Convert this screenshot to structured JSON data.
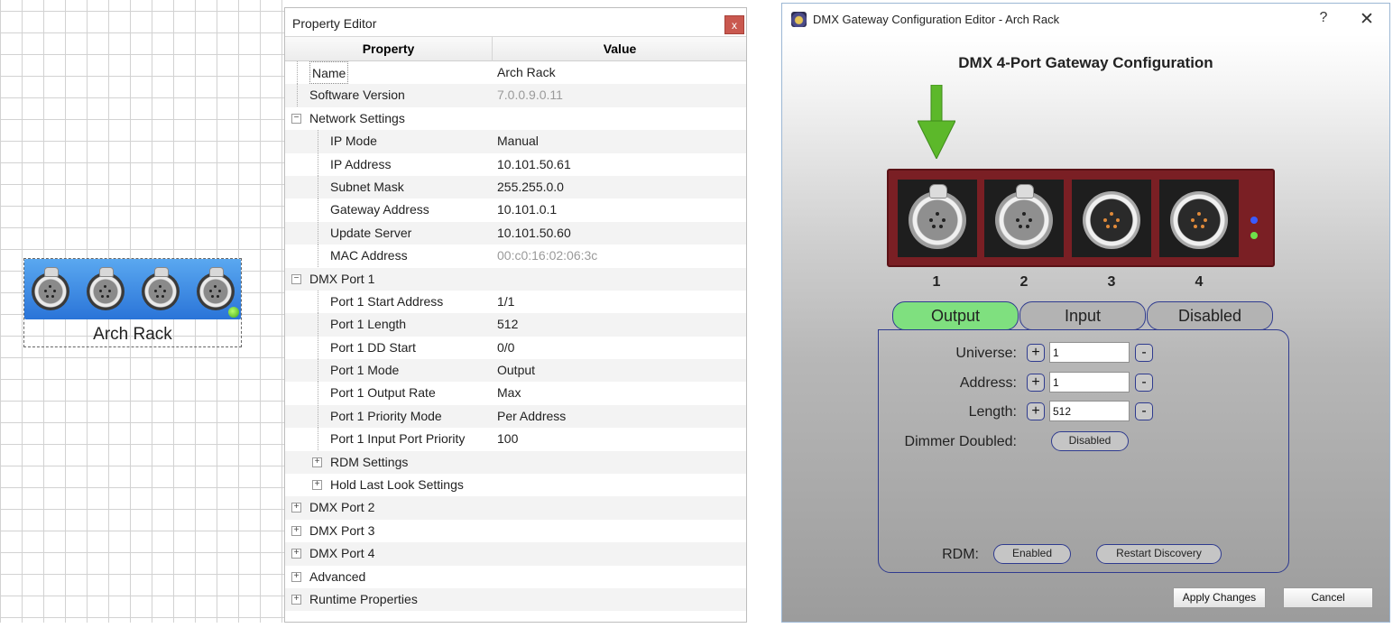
{
  "canvas": {
    "node": {
      "label": "Arch Rack"
    }
  },
  "property_editor": {
    "title": "Property Editor",
    "close_label": "x",
    "header": {
      "property": "Property",
      "value": "Value"
    },
    "rows": [
      {
        "name": "Name",
        "value": "Arch Rack"
      },
      {
        "name": "Software Version",
        "value": "7.0.0.9.0.11"
      },
      {
        "name": "Network Settings",
        "value": ""
      },
      {
        "name": "IP Mode",
        "value": "Manual"
      },
      {
        "name": "IP Address",
        "value": "10.101.50.61"
      },
      {
        "name": "Subnet Mask",
        "value": "255.255.0.0"
      },
      {
        "name": "Gateway Address",
        "value": "10.101.0.1"
      },
      {
        "name": "Update Server",
        "value": "10.101.50.60"
      },
      {
        "name": "MAC Address",
        "value": "00:c0:16:02:06:3c"
      },
      {
        "name": "DMX Port 1",
        "value": ""
      },
      {
        "name": "Port 1 Start Address",
        "value": "1/1"
      },
      {
        "name": "Port 1 Length",
        "value": "512"
      },
      {
        "name": "Port 1 DD Start",
        "value": "0/0"
      },
      {
        "name": "Port 1 Mode",
        "value": "Output"
      },
      {
        "name": "Port 1 Output Rate",
        "value": "Max"
      },
      {
        "name": "Port 1 Priority Mode",
        "value": "Per Address"
      },
      {
        "name": "Port 1 Input Port Priority",
        "value": "100"
      },
      {
        "name": "RDM Settings",
        "value": ""
      },
      {
        "name": "Hold Last Look Settings",
        "value": ""
      },
      {
        "name": "DMX Port 2",
        "value": ""
      },
      {
        "name": "DMX Port 3",
        "value": ""
      },
      {
        "name": "DMX Port 4",
        "value": ""
      },
      {
        "name": "Advanced",
        "value": ""
      },
      {
        "name": "Runtime Properties",
        "value": ""
      }
    ]
  },
  "dialog": {
    "title": "DMX Gateway Configuration Editor - Arch Rack",
    "help_label": "?",
    "close_label": "✕",
    "heading": "DMX 4-Port Gateway Configuration",
    "ports": [
      "1",
      "2",
      "3",
      "4"
    ],
    "modes": [
      "Output",
      "Input",
      "Disabled"
    ],
    "active_mode": "Output",
    "fields": {
      "universe_label": "Universe:",
      "universe_value": "1",
      "address_label": "Address:",
      "address_value": "1",
      "length_label": "Length:",
      "length_value": "512",
      "plus": "+",
      "minus": "-"
    },
    "dimmer_doubled": {
      "label": "Dimmer Doubled:",
      "value": "Disabled"
    },
    "rdm": {
      "label": "RDM:",
      "value": "Enabled",
      "restart": "Restart Discovery"
    },
    "buttons": {
      "apply": "Apply Changes",
      "cancel": "Cancel"
    },
    "colors": {
      "active_tab": "#7fe07f",
      "outline": "#2f3b8f",
      "gateway_body": "#7a1f24",
      "arrow": "#5cb82a"
    }
  }
}
